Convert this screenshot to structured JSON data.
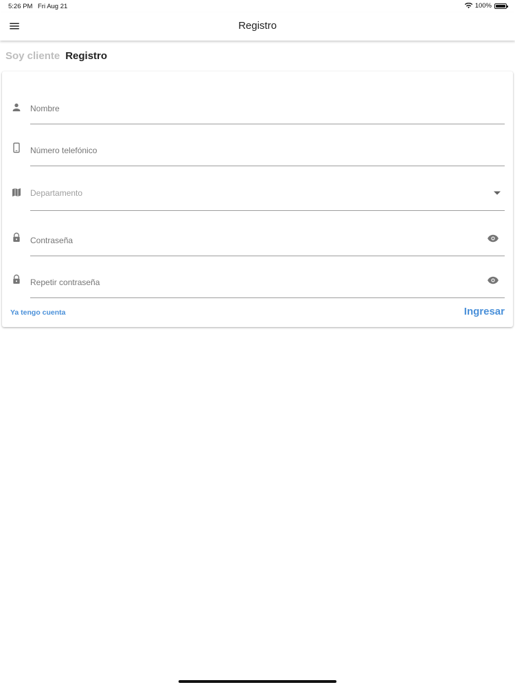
{
  "status_bar": {
    "time": "5:26 PM",
    "date": "Fri Aug 21",
    "battery": "100%"
  },
  "app_bar": {
    "title": "Registro",
    "menu_icon": "hamburger-menu-icon"
  },
  "tabs": [
    {
      "label": "Soy cliente",
      "active": false
    },
    {
      "label": "Registro",
      "active": true
    }
  ],
  "form": {
    "name": {
      "placeholder": "Nombre",
      "icon": "person-icon"
    },
    "phone": {
      "placeholder": "Número telefónico",
      "icon": "phone-icon"
    },
    "department": {
      "label": "Departamento",
      "icon": "map-icon"
    },
    "password": {
      "placeholder": "Contraseña",
      "icon": "lock-icon"
    },
    "repeat_password": {
      "placeholder": "Repetir contraseña",
      "icon": "lock-icon"
    }
  },
  "actions": {
    "have_account": "Ya tengo cuenta",
    "login": "Ingresar"
  },
  "colors": {
    "accent": "#4a90d9",
    "icon_gray": "#757575",
    "inactive_tab": "#bdbdbd"
  }
}
